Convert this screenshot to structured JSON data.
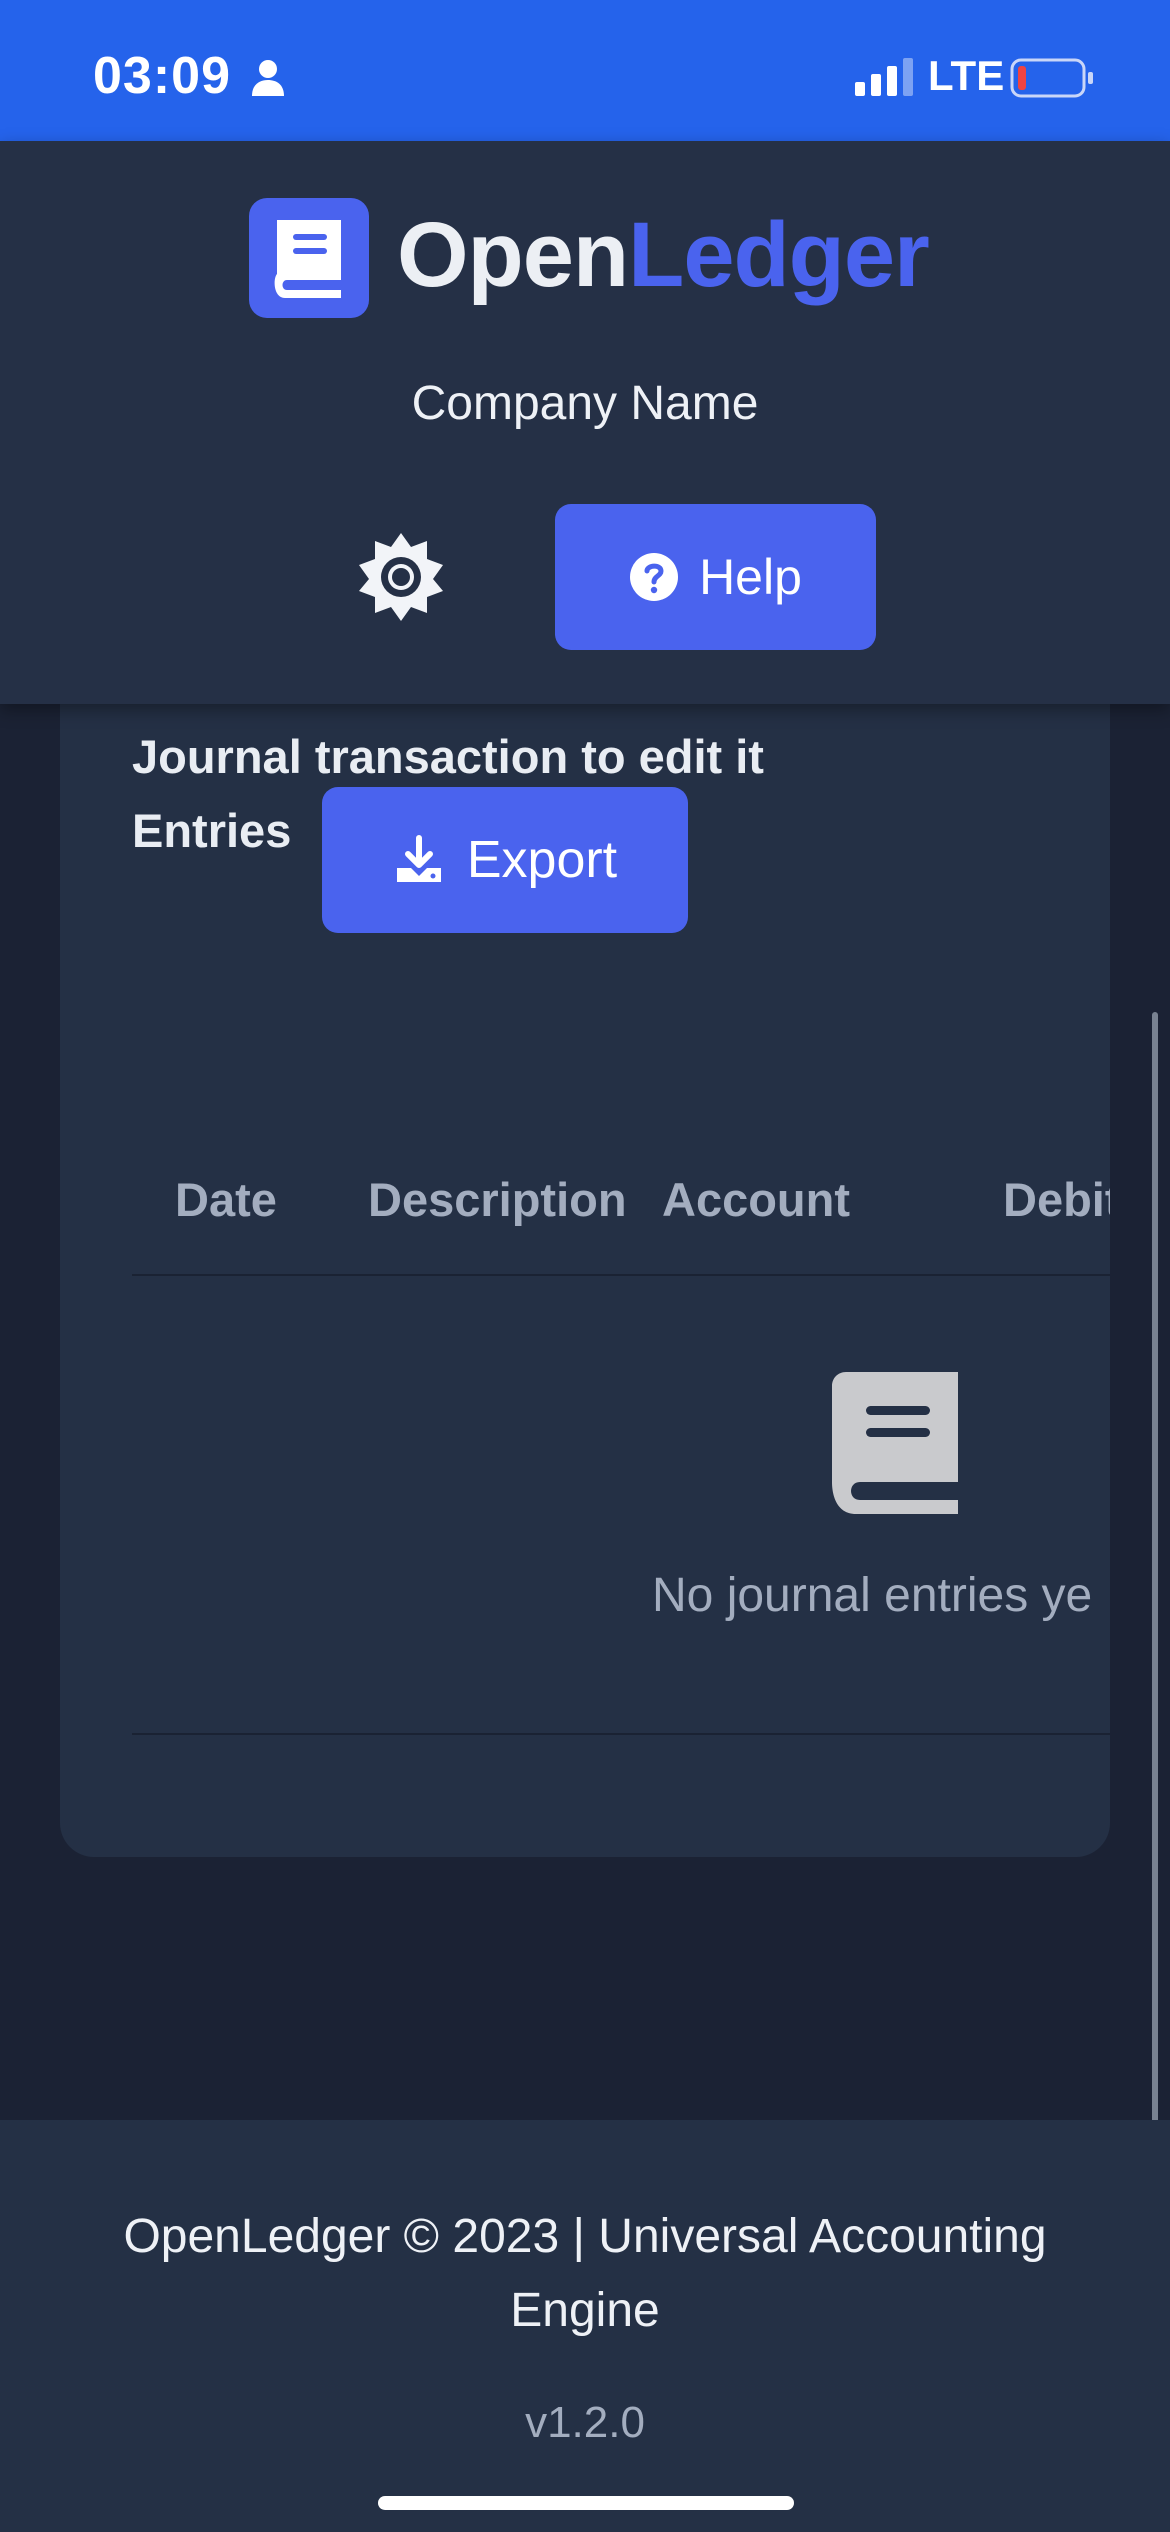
{
  "status_bar": {
    "time": "03:09",
    "network": "LTE"
  },
  "header": {
    "brand_part1": "Open",
    "brand_part2": "Ledger",
    "company_name": "Company Name",
    "help_label": "Help"
  },
  "journal": {
    "title_line1": "Journal transaction to edit it",
    "title_line2": "Entries",
    "export_label": "Export",
    "columns": [
      "Date",
      "Description",
      "Account",
      "Debit"
    ],
    "empty_message": "No journal entries ye"
  },
  "footer": {
    "text": "OpenLedger © 2023 | Universal Accounting Engine",
    "version": "v1.2.0"
  },
  "colors": {
    "status_bar": "#2563eb",
    "accent": "#4a63ee",
    "header_bg": "#253046",
    "page_bg": "#1b2234",
    "card_bg": "#243045",
    "battery_low": "#ef4444"
  },
  "icons": {
    "status_person": "person-icon",
    "signal": "signal-bars-icon",
    "battery": "battery-low-icon",
    "logo": "book-icon",
    "settings": "gear-icon",
    "help": "question-circle-icon",
    "export": "download-icon",
    "empty_state": "book-icon"
  }
}
